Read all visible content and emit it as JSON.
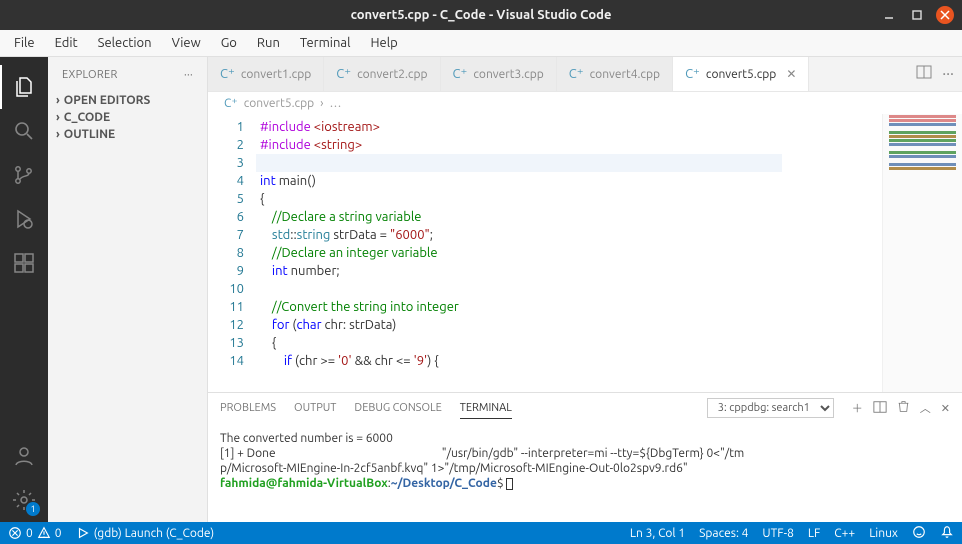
{
  "window": {
    "title": "convert5.cpp - C_Code - Visual Studio Code"
  },
  "menu": [
    "File",
    "Edit",
    "Selection",
    "View",
    "Go",
    "Run",
    "Terminal",
    "Help"
  ],
  "sidebar": {
    "title": "EXPLORER",
    "sections": [
      "OPEN EDITORS",
      "C_CODE",
      "OUTLINE"
    ]
  },
  "tabs": [
    {
      "label": "convert1.cpp",
      "active": false
    },
    {
      "label": "convert2.cpp",
      "active": false
    },
    {
      "label": "convert3.cpp",
      "active": false
    },
    {
      "label": "convert4.cpp",
      "active": false
    },
    {
      "label": "convert5.cpp",
      "active": true
    }
  ],
  "breadcrumb": {
    "file": "convert5.cpp",
    "more": "…"
  },
  "code": {
    "lines": [
      {
        "n": 1,
        "tokens": [
          [
            "inc",
            "#include"
          ],
          [
            "punct",
            " "
          ],
          [
            "incpath",
            "<iostream>"
          ]
        ]
      },
      {
        "n": 2,
        "tokens": [
          [
            "inc",
            "#include"
          ],
          [
            "punct",
            " "
          ],
          [
            "incpath",
            "<string>"
          ]
        ]
      },
      {
        "n": 3,
        "tokens": [],
        "current": true
      },
      {
        "n": 4,
        "tokens": [
          [
            "type",
            "int"
          ],
          [
            "punct",
            " "
          ],
          [
            "ident",
            "main"
          ],
          [
            "punct",
            "()"
          ]
        ]
      },
      {
        "n": 5,
        "tokens": [
          [
            "punct",
            "{"
          ]
        ]
      },
      {
        "n": 6,
        "tokens": [
          [
            "punct",
            "    "
          ],
          [
            "cmt",
            "//Declare a string variable"
          ]
        ]
      },
      {
        "n": 7,
        "tokens": [
          [
            "punct",
            "    "
          ],
          [
            "ns",
            "std"
          ],
          [
            "punct",
            "::"
          ],
          [
            "ns",
            "string"
          ],
          [
            "punct",
            " strData = "
          ],
          [
            "str",
            "\"6000\""
          ],
          [
            "punct",
            ";"
          ]
        ]
      },
      {
        "n": 8,
        "tokens": [
          [
            "punct",
            "    "
          ],
          [
            "cmt",
            "//Declare an integer variable"
          ]
        ]
      },
      {
        "n": 9,
        "tokens": [
          [
            "punct",
            "    "
          ],
          [
            "type",
            "int"
          ],
          [
            "punct",
            " number;"
          ]
        ]
      },
      {
        "n": 10,
        "tokens": []
      },
      {
        "n": 11,
        "tokens": [
          [
            "punct",
            "    "
          ],
          [
            "cmt",
            "//Convert the string into integer"
          ]
        ]
      },
      {
        "n": 12,
        "tokens": [
          [
            "punct",
            "    "
          ],
          [
            "kw",
            "for"
          ],
          [
            "punct",
            " ("
          ],
          [
            "type",
            "char"
          ],
          [
            "punct",
            " chr: strData)"
          ]
        ]
      },
      {
        "n": 13,
        "tokens": [
          [
            "punct",
            "    {"
          ]
        ]
      },
      {
        "n": 14,
        "tokens": [
          [
            "punct",
            "        "
          ],
          [
            "kw",
            "if"
          ],
          [
            "punct",
            " (chr >= "
          ],
          [
            "char",
            "'0'"
          ],
          [
            "punct",
            " && chr <= "
          ],
          [
            "char",
            "'9'"
          ],
          [
            "punct",
            ") {"
          ]
        ]
      }
    ]
  },
  "panel": {
    "tabs": [
      "PROBLEMS",
      "OUTPUT",
      "DEBUG CONSOLE",
      "TERMINAL"
    ],
    "active_tab": "TERMINAL",
    "select": "3: cppdbg: search1",
    "terminal": {
      "line1": "The converted number is = 6000",
      "line2a": "[1] + Done",
      "line2b": "\"/usr/bin/gdb\" --interpreter=mi --tty=${DbgTerm} 0<\"/tm",
      "line3": "p/Microsoft-MIEngine-In-2cf5anbf.kvq\" 1>\"/tmp/Microsoft-MIEngine-Out-0lo2spv9.rd6\"",
      "prompt_user": "fahmida@fahmida-VirtualBox",
      "prompt_path": "~/Desktop/C_Code",
      "prompt_end": "$ "
    }
  },
  "status": {
    "errors": "0",
    "warnings": "0",
    "launch": "(gdb) Launch (C_Code)",
    "ln": "Ln 3, Col 1",
    "spaces": "Spaces: 4",
    "encoding": "UTF-8",
    "eol": "LF",
    "lang": "C++",
    "os": "Linux"
  },
  "settings_badge": "1"
}
